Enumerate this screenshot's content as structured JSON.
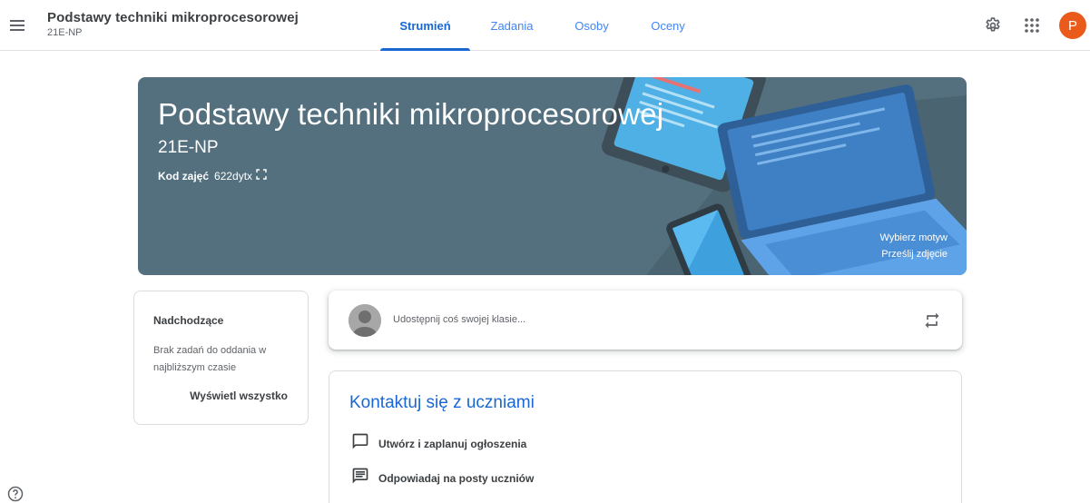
{
  "header": {
    "class_title": "Podstawy techniki mikroprocesorowej",
    "class_section": "21E-NP",
    "tabs": [
      {
        "label": "Strumień",
        "active": true
      },
      {
        "label": "Zadania",
        "active": false
      },
      {
        "label": "Osoby",
        "active": false
      },
      {
        "label": "Oceny",
        "active": false
      }
    ],
    "icons": {
      "menu": "menu-icon",
      "settings": "gear-icon",
      "apps": "apps-grid-icon"
    },
    "avatar_letter": "P",
    "avatar_color": "#ea5b1b"
  },
  "banner": {
    "title": "Podstawy techniki mikroprocesorowej",
    "section": "21E-NP",
    "code_label": "Kod zajęć",
    "code_value": "622dytx",
    "code_icon": "fullscreen-icon",
    "choose_theme": "Wybierz motyw",
    "upload_photo": "Prześlij zdjęcie",
    "background_color": "#54707f"
  },
  "upcoming": {
    "title": "Nadchodzące",
    "empty_text": "Brak zadań do oddania w najbliższym czasie",
    "view_all": "Wyświetl wszystko"
  },
  "share": {
    "placeholder": "Udostępnij coś swojej klasie...",
    "repost_icon": "repost-icon"
  },
  "contact": {
    "title": "Kontaktuj się z uczniami",
    "items": [
      {
        "label": "Utwórz i zaplanuj ogłoszenia",
        "icon": "announcement-icon"
      },
      {
        "label": "Odpowiadaj na posty uczniów",
        "icon": "comment-icon"
      }
    ]
  },
  "colors": {
    "primary": "#1967d2",
    "tab_inactive": "#4285f4"
  }
}
